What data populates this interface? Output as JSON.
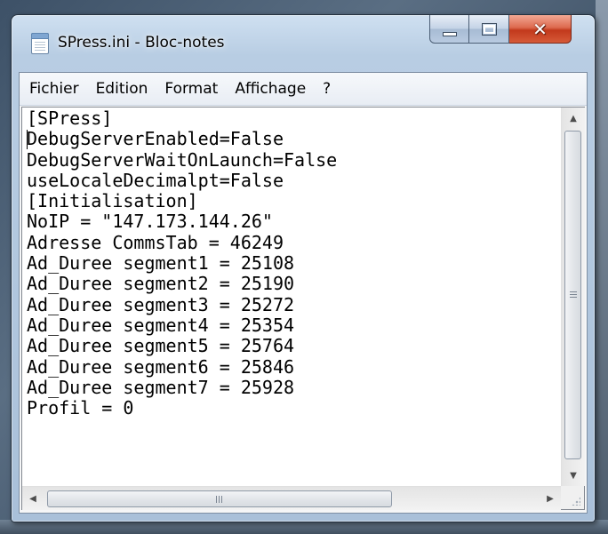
{
  "window": {
    "title": "SPress.ini - Bloc-notes",
    "controls": {
      "minimize": "minimize",
      "maximize": "maximize",
      "close": "close"
    }
  },
  "menubar": {
    "items": [
      {
        "label": "Fichier"
      },
      {
        "label": "Edition"
      },
      {
        "label": "Format"
      },
      {
        "label": "Affichage"
      },
      {
        "label": "?"
      }
    ]
  },
  "editor": {
    "lines": [
      "[SPress]",
      "DebugServerEnabled=False",
      "DebugServerWaitOnLaunch=False",
      "useLocaleDecimalpt=False",
      "[Initialisation]",
      "NoIP = \"147.173.144.26\"",
      "Adresse CommsTab = 46249",
      "Ad_Duree segment1 = 25108",
      "Ad_Duree segment2 = 25190",
      "Ad_Duree segment3 = 25272",
      "Ad_Duree segment4 = 25354",
      "Ad_Duree segment5 = 25764",
      "Ad_Duree segment6 = 25846",
      "Ad_Duree segment7 = 25928",
      "Profil = 0"
    ]
  },
  "scrollbars": {
    "up_arrow": "▲",
    "down_arrow": "▼",
    "left_arrow": "◀",
    "right_arrow": "▶"
  },
  "colors": {
    "editor_background": "#ffffff",
    "text": "#000000",
    "close_button": "#c2391c"
  }
}
